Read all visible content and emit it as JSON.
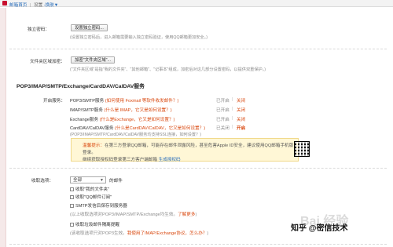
{
  "breadcrumb": {
    "home": "邮箱首页",
    "sep": "|",
    "settings": "设置",
    "current": "-换肤▼"
  },
  "standalone_password": {
    "label": "独立密码：",
    "button": "设置独立密码...",
    "hint": "(设置独立密码后，进入邮箱需要输入独立密码验证，使用QQ邮箱更加安全。)"
  },
  "folder_password": {
    "label": "文件夹区域加密：",
    "button": "加密\"文件夹区域\"...",
    "hint": "(\"文件夹区域\"是指\"我的文件夹\"、\"其他邮箱\"、\"记事本\"组成，加密后对这几部分设置密码，以提供双重保护。)"
  },
  "section_title": "POP3/IMAP/SMTP/Exchange/CardDAV/CalDAV服务",
  "services": {
    "label": "开启服务：",
    "items": [
      {
        "name": "POP3/SMTP服务",
        "q": "(如何使用 Foxmail 等软件收发邮件？)",
        "status": "已开启",
        "sep": "|",
        "toggle": "关闭"
      },
      {
        "name": "IMAP/SMTP服务",
        "q": "(什么是 IMAP，它又是如何设置？)",
        "status": "已开启",
        "sep": "|",
        "toggle": "关闭"
      },
      {
        "name": "Exchange服务",
        "q": "(什么是Exchange，它又是如何设置？)",
        "status": "已开启",
        "sep": "|",
        "toggle": "关闭"
      },
      {
        "name": "CardDAV/CalDAV服务",
        "q": "(什么是CardDAV/CalDAV，它又是如何设置？)",
        "status": "已关闭",
        "sep": "|",
        "toggle": "开启"
      }
    ],
    "ssl_hint": "(POP3/IMAP/SMTP/CardDAV/CalDAV服务均支持SSL连接，如何设置？)"
  },
  "tip": {
    "prefix": "温馨提示：",
    "body": "在第三方登录QQ邮箱，可能存在邮件泄露风险，甚至危害Apple ID安全，建议使用QQ邮箱手机版登录。",
    "line2": "继续获取授权码登录第三方客户端邮箱",
    "link": "生成授权码"
  },
  "receive": {
    "label": "收取选项：",
    "select_value": "全部",
    "after_select": "的邮件",
    "options": [
      "收取\"我的文件夹\"",
      "收取\"QQ邮件订阅\"",
      "SMTP发信后保存到服务器"
    ],
    "note1": "(以上收取选项对POP3/IMAP/SMTP/Exchange均生效。",
    "note1_link": "了解更多",
    "note1_end": ")",
    "option4": "收取垃圾邮件隔离提醒",
    "note2": "(该收取选项只对POP3生效。",
    "note2_warn": "我使用了IMAP/Exchange协议，怎么办？",
    "note2_end": ")"
  },
  "watermark": {
    "text1": "Bai 经验",
    "text2": "知乎 @密信技术"
  }
}
